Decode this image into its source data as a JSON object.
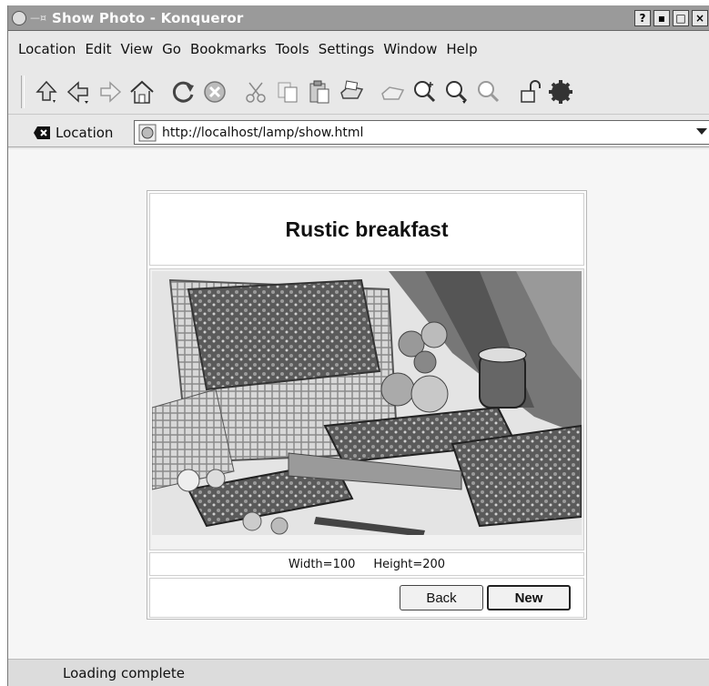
{
  "window": {
    "title": "Show Photo - Konqueror",
    "buttons": [
      "?",
      "▪",
      "□",
      "×"
    ]
  },
  "menu": [
    "Location",
    "Edit",
    "View",
    "Go",
    "Bookmarks",
    "Tools",
    "Settings",
    "Window",
    "Help"
  ],
  "toolbar": {
    "icons": [
      "up-arrow-icon",
      "back-arrow-icon",
      "forward-arrow-icon",
      "home-icon",
      "reload-icon",
      "stop-icon",
      "cut-icon",
      "copy-icon",
      "paste-icon",
      "print-icon",
      "print-frame-icon",
      "zoom-in-icon",
      "zoom-out-icon",
      "zoom-icon",
      "security-lock-icon",
      "konqueror-gear-icon"
    ]
  },
  "location": {
    "label": "Location",
    "url": "http://localhost/lamp/show.html"
  },
  "page": {
    "title": "Rustic breakfast",
    "width_text": "Width=100",
    "height_text": "Height=200",
    "back_label": "Back",
    "new_label": "New"
  },
  "status": {
    "text": "Loading complete"
  },
  "colors": {
    "titlebar": "#9a9a9a",
    "chrome": "#e8e8e8",
    "content_bg": "#f6f6f6"
  }
}
